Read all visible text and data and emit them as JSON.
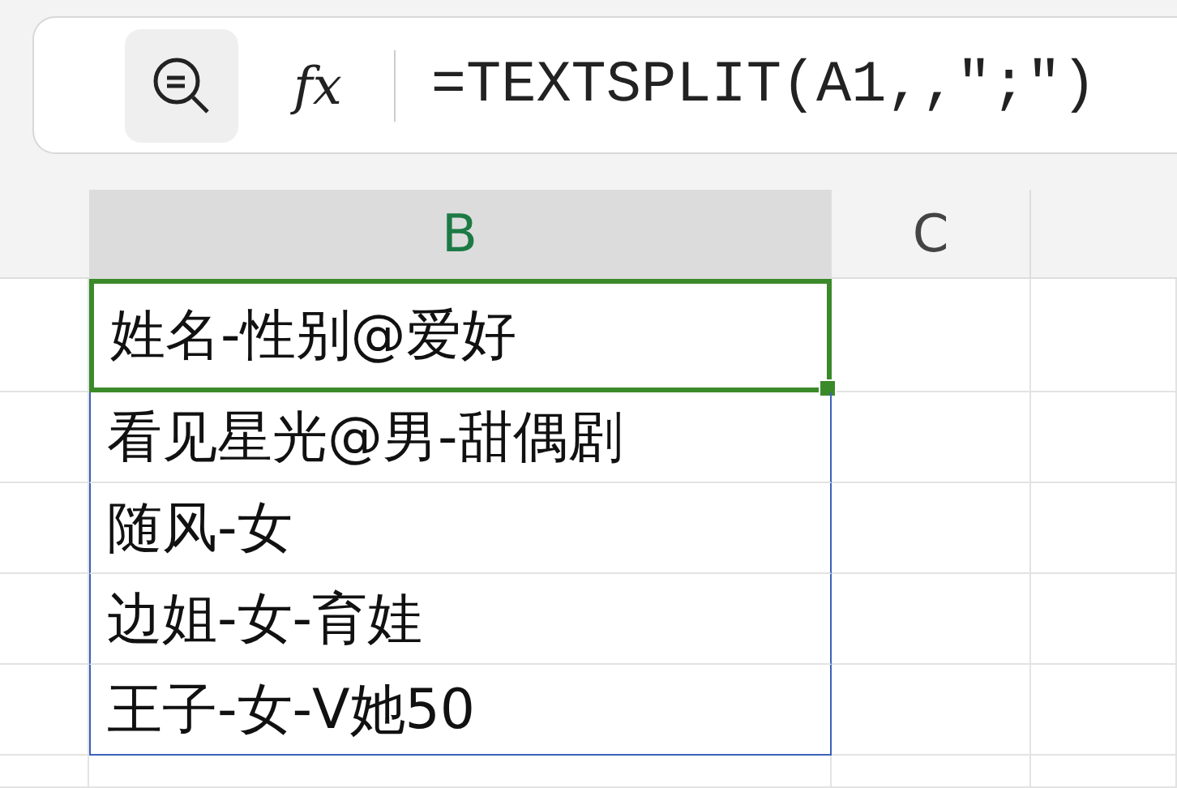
{
  "formula_bar": {
    "function_label": "fx",
    "formula": "=TEXTSPLIT(A1,,″;″)"
  },
  "columns": [
    {
      "label": "B",
      "selected": true
    },
    {
      "label": "C",
      "selected": false
    }
  ],
  "cells": [
    {
      "text": "姓名-性别@爱好",
      "selected": true
    },
    {
      "text": "看见星光@男-甜偶剧",
      "selected": false
    },
    {
      "text": "随风-女",
      "selected": false
    },
    {
      "text": "边姐-女-育娃",
      "selected": false
    },
    {
      "text": "王子-女-V她50",
      "selected": false
    }
  ]
}
